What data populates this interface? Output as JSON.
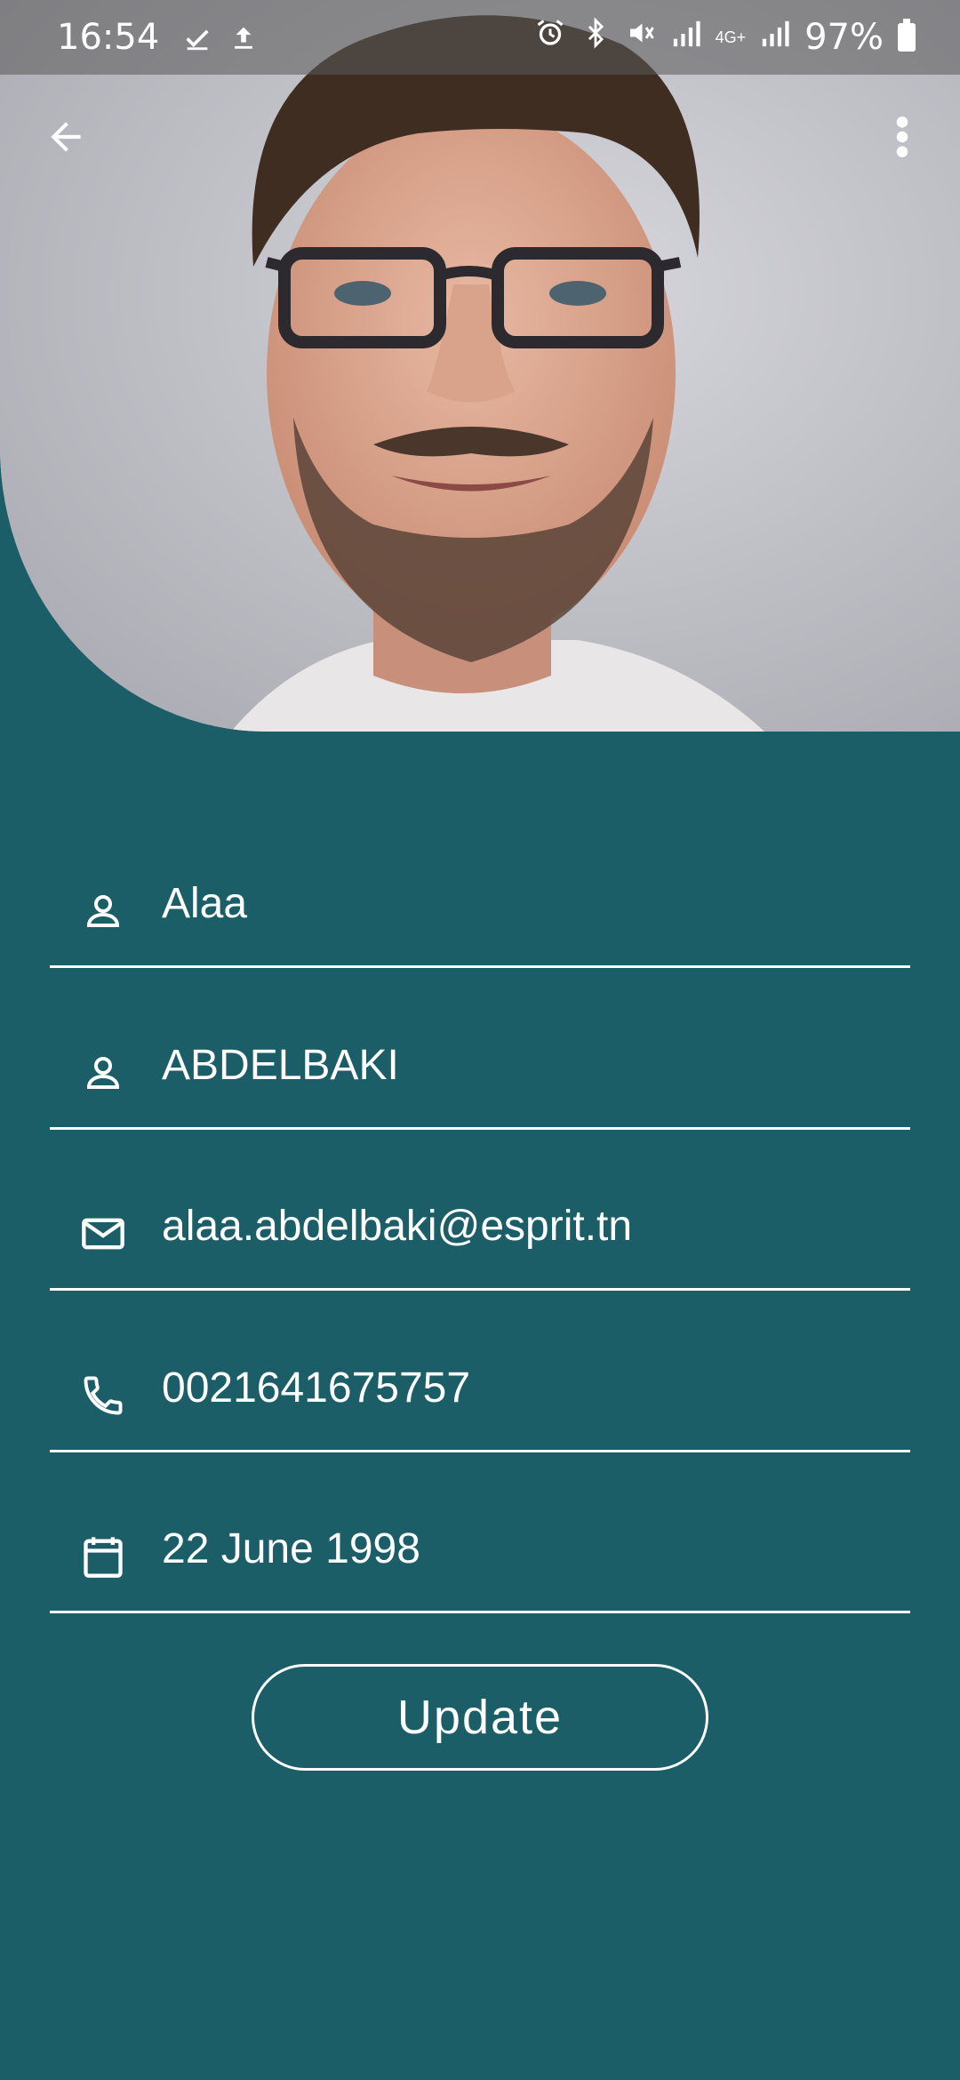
{
  "status_bar": {
    "time": "16:54",
    "battery": "97%",
    "left_icons": [
      "download-done-icon",
      "upload-icon"
    ],
    "right_icons": [
      "alarm-icon",
      "bluetooth-icon",
      "mute-icon",
      "signal-icon",
      "4g-icon",
      "signal-icon",
      "battery-icon"
    ]
  },
  "app_bar": {
    "back_icon": "arrow-back-icon",
    "menu_icon": "more-vert-icon"
  },
  "profile": {
    "first_name": "Alaa",
    "last_name": "ABDELBAKI",
    "email": "alaa.abdelbaki@esprit.tn",
    "phone": "0021641675757",
    "birth_date": "22 June 1998"
  },
  "actions": {
    "update_label": "Update"
  },
  "colors": {
    "background": "#1b5e67",
    "foreground": "#ffffff"
  }
}
